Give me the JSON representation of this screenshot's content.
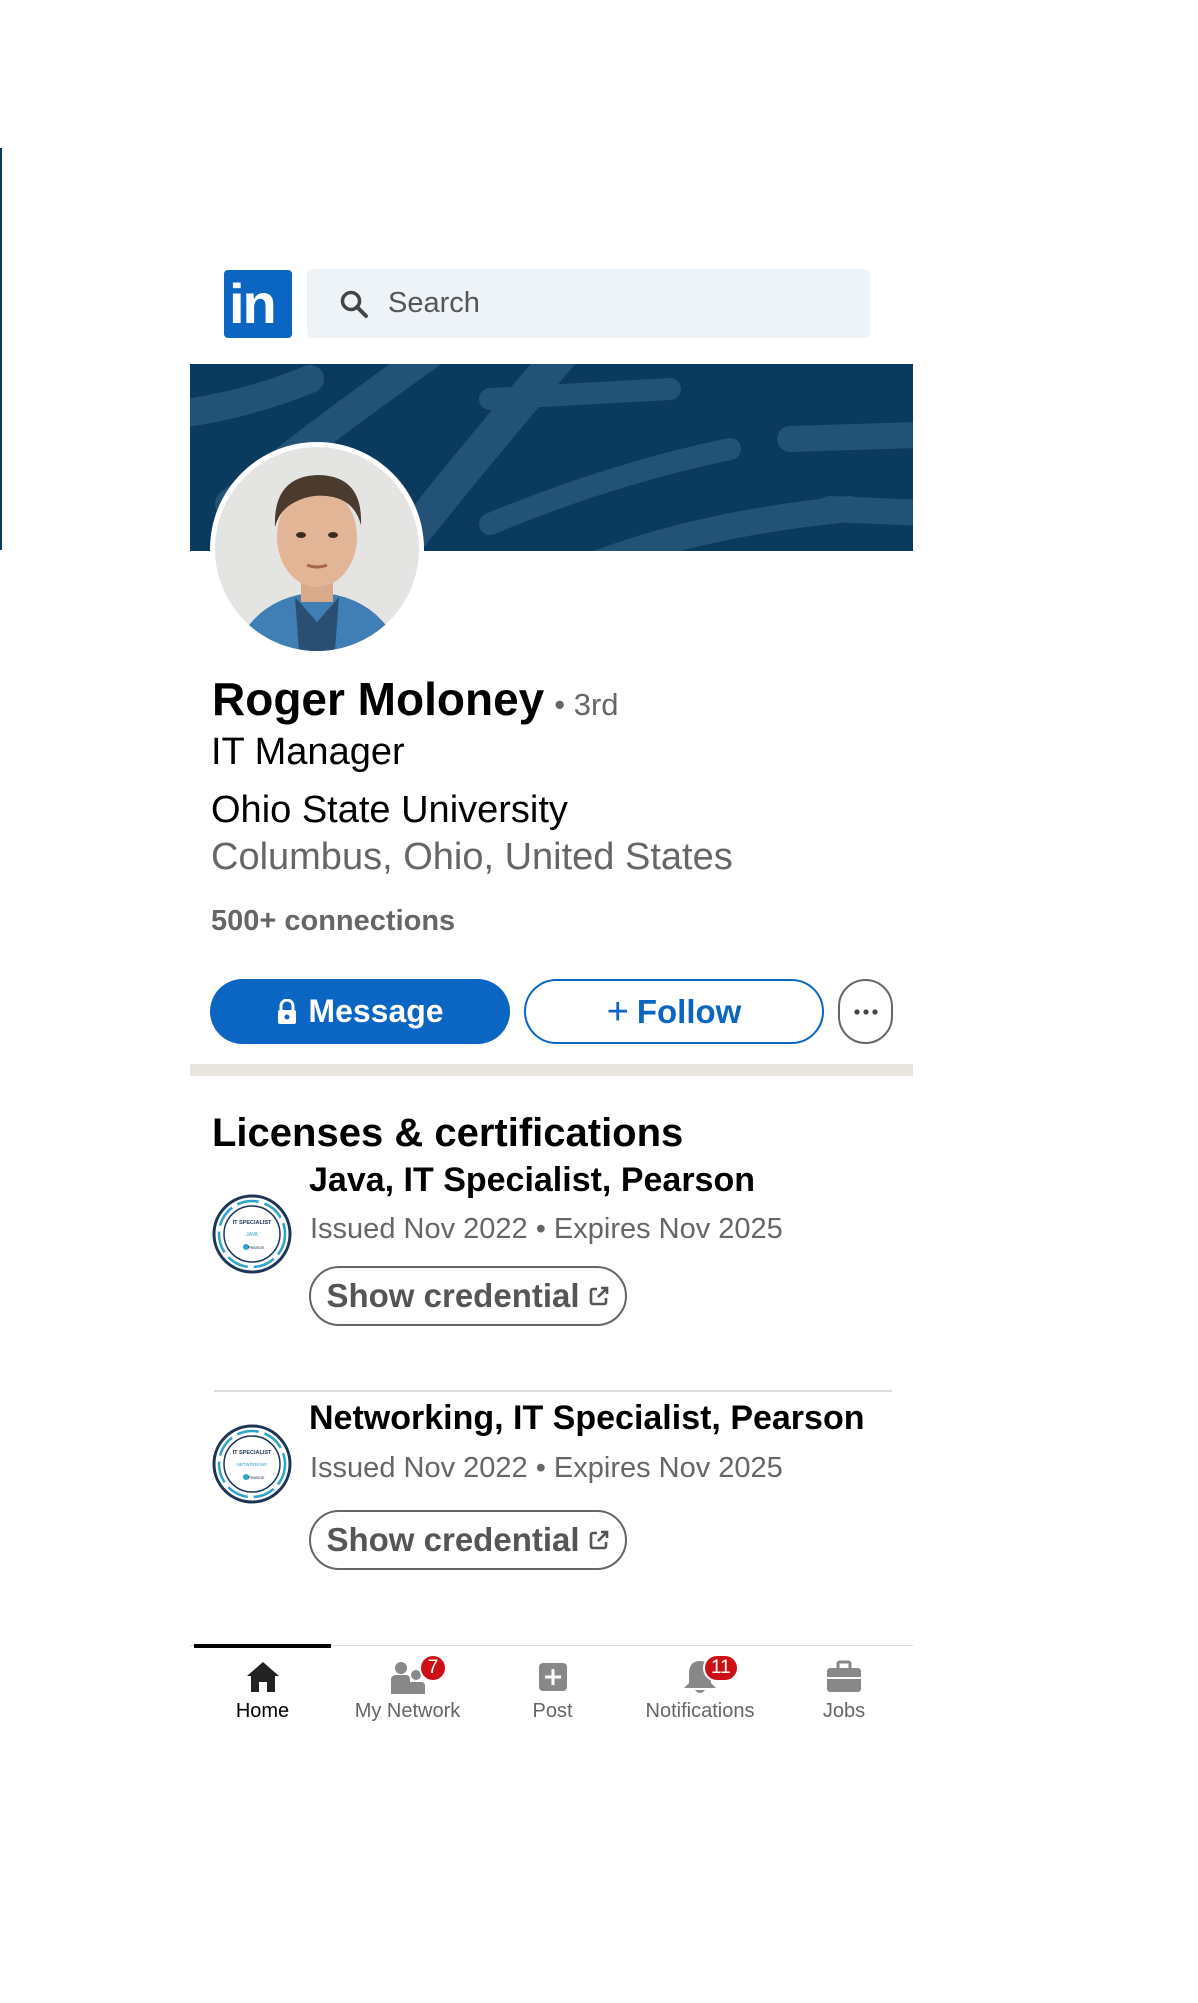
{
  "header": {
    "logo_text": "in",
    "search": {
      "placeholder": "Search"
    }
  },
  "profile": {
    "name": "Roger Moloney",
    "degree": "• 3rd",
    "headline": "IT Manager",
    "organization": "Ohio State University",
    "location": "Columbus, Ohio, United States",
    "connections": "500+ connections"
  },
  "actions": {
    "message_label": "Message",
    "follow_label": "Follow",
    "follow_prefix": "+"
  },
  "certifications": {
    "title": "Licenses & certifications",
    "items": [
      {
        "name": "Java, IT Specialist, Pearson",
        "meta": "Issued Nov 2022 • Expires Nov 2025",
        "button": "Show credential",
        "badge_text": "JAVA"
      },
      {
        "name": "Networking, IT Specialist, Pearson",
        "meta": "Issued Nov 2022 • Expires Nov 2025",
        "button": "Show credential",
        "badge_text": "NETWORKING"
      }
    ]
  },
  "nav": {
    "items": [
      {
        "label": "Home",
        "icon": "home-icon",
        "active": true
      },
      {
        "label": "My Network",
        "icon": "my-network-icon",
        "badge": "7"
      },
      {
        "label": "Post",
        "icon": "post-icon"
      },
      {
        "label": "Notifications",
        "icon": "bell-icon",
        "badge": "11"
      },
      {
        "label": "Jobs",
        "icon": "briefcase-icon"
      }
    ]
  },
  "colors": {
    "brand": "#0a66c2",
    "banner": "#0a3a5e",
    "badge": "#cc1016"
  }
}
